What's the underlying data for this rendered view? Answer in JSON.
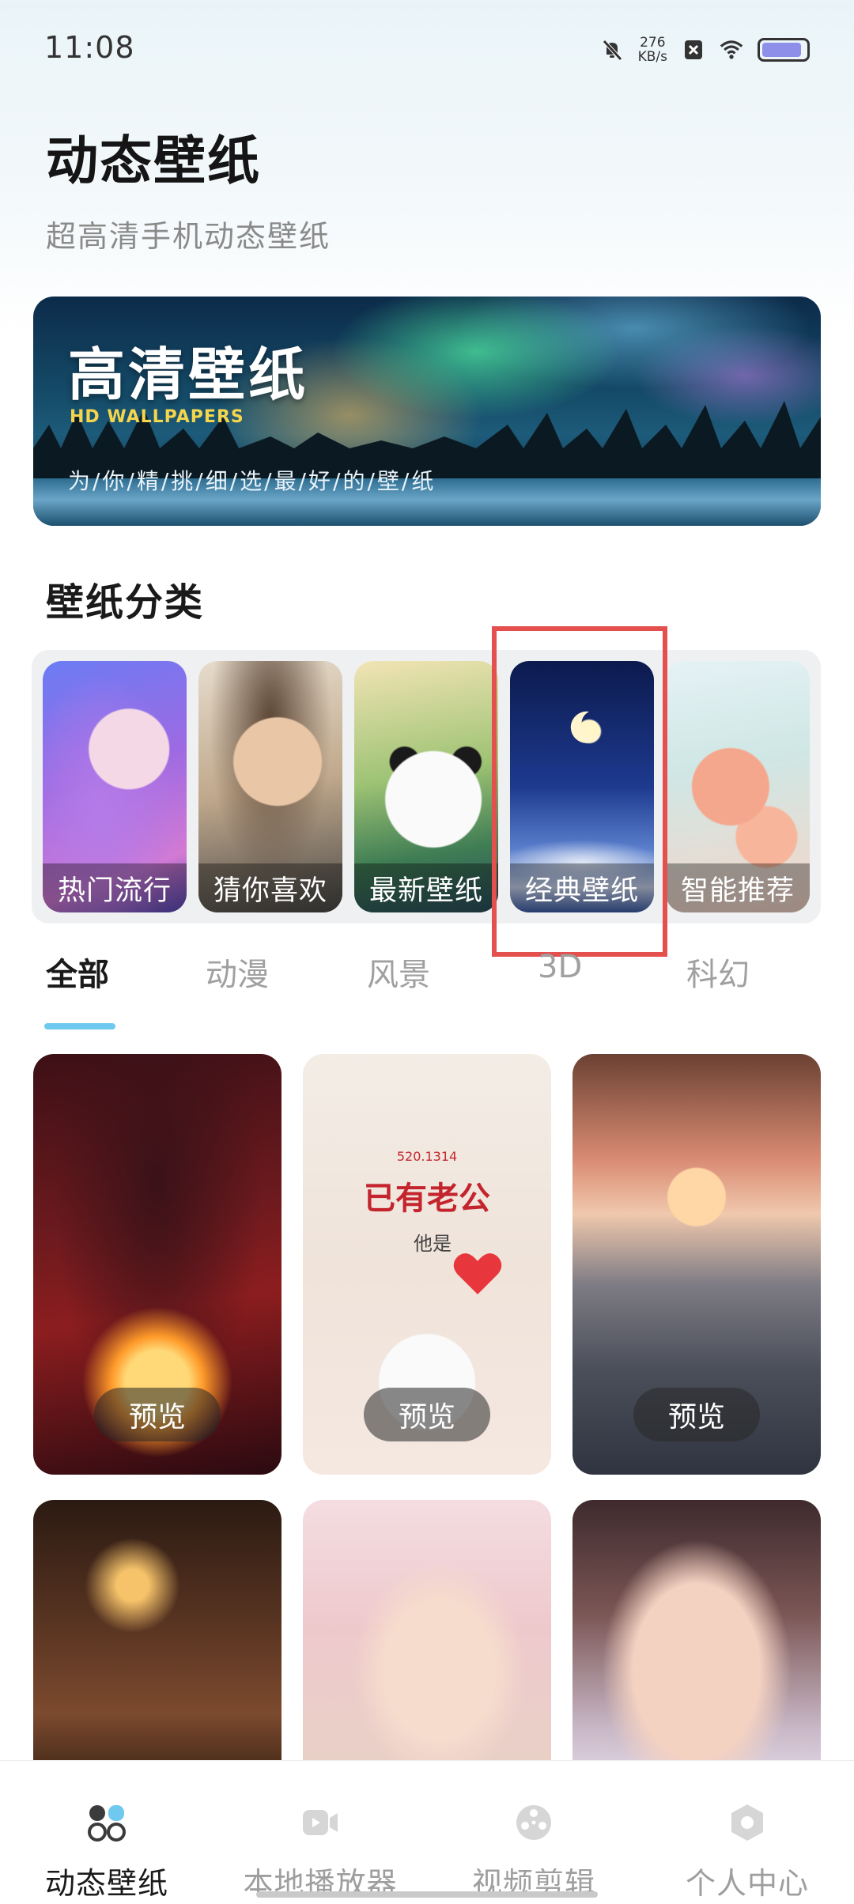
{
  "status_bar": {
    "time": "11:08",
    "speed_value": "276",
    "speed_unit": "KB/s",
    "battery_level": 0.9
  },
  "header": {
    "title": "动态壁纸",
    "subtitle": "超高清手机动态壁纸"
  },
  "banner": {
    "title": "高清壁纸",
    "subtitle": "HD WALLPAPERS",
    "slogan": "为/你/精/挑/细/选/最/好/的/壁/纸"
  },
  "categories_section": {
    "title": "壁纸分类",
    "items": [
      {
        "label": "热门流行"
      },
      {
        "label": "猜你喜欢"
      },
      {
        "label": "最新壁纸"
      },
      {
        "label": "经典壁纸"
      },
      {
        "label": "智能推荐"
      }
    ]
  },
  "tabs": [
    {
      "label": "全部",
      "active": true
    },
    {
      "label": "动漫"
    },
    {
      "label": "风景"
    },
    {
      "label": "3D"
    },
    {
      "label": "科幻"
    }
  ],
  "wallpapers": {
    "preview_label": "预览",
    "card2_number": "520.1314",
    "card2_headline": "已有老公",
    "card2_line": "他是"
  },
  "bottom_nav": [
    {
      "label": "动态壁纸",
      "icon": "grid-icon",
      "active": true
    },
    {
      "label": "本地播放器",
      "icon": "video-icon"
    },
    {
      "label": "视频剪辑",
      "icon": "film-reel-icon"
    },
    {
      "label": "个人中心",
      "icon": "profile-icon"
    }
  ],
  "colors": {
    "accent": "#6fc9ee",
    "highlight": "#e3504e"
  }
}
